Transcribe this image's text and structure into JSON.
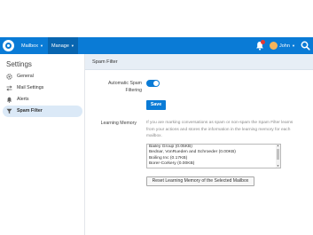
{
  "topbar": {
    "menus": [
      {
        "label": "Mailbox"
      },
      {
        "label": "Manage"
      }
    ],
    "user": {
      "name": "John"
    }
  },
  "sidebar": {
    "title": "Settings",
    "items": [
      {
        "label": "General",
        "icon": "gear-icon"
      },
      {
        "label": "Mail Settings",
        "icon": "arrows-icon"
      },
      {
        "label": "Alerts",
        "icon": "bell-icon"
      },
      {
        "label": "Spam Filter",
        "icon": "filter-icon",
        "active": true
      }
    ]
  },
  "main": {
    "title": "Spam Filter",
    "auto_spam": {
      "label_line1": "Automatic Spam",
      "label_line2": "Filtering",
      "enabled": true
    },
    "save_label": "Save",
    "learning": {
      "label": "Learning Memory",
      "description": "If you are marking conversations as spam or non-spam the Spam Filter learns from your actions and stores the information in the learning memory for each mailbox.",
      "items": [
        "Bailey Group (0.05KB)",
        "Bednar, VonRueden and Schroeder (0.00KB)",
        "Boiling Inc (0.17KB)",
        "Borer-Corkery (0.00KB)"
      ],
      "reset_label": "Reset Learning Memory of the Selected Mailbox"
    }
  },
  "colors": {
    "brand": "#0a7bd6",
    "active_item_bg": "#dbe9f7",
    "notification": "#e53935"
  }
}
